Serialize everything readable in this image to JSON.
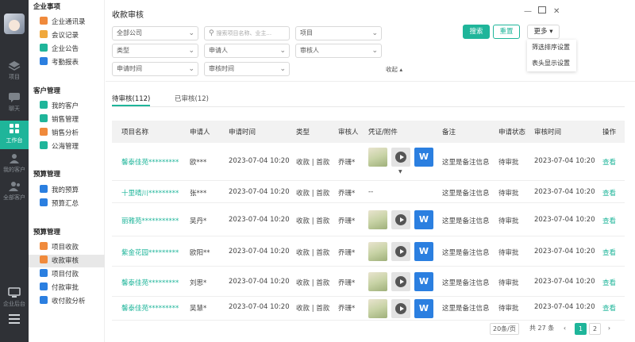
{
  "rail": {
    "items": [
      {
        "label": "项目",
        "icon": "layers-icon"
      },
      {
        "label": "聊天",
        "icon": "chat-icon"
      },
      {
        "label": "工作台",
        "icon": "grid-icon"
      },
      {
        "label": "我的客户",
        "icon": "users-icon"
      },
      {
        "label": "全部客户",
        "icon": "user-icon"
      },
      {
        "label": "企业后台",
        "icon": "monitor-icon"
      }
    ],
    "accent": "#1fb59a"
  },
  "submenu": {
    "sections": [
      {
        "title": "企业事项",
        "items": [
          "企业通讯录",
          "会议记录",
          "企业公告",
          "考勤报表"
        ]
      },
      {
        "title": "客户管理",
        "items": [
          "我的客户",
          "销售管理",
          "销售分析",
          "公海管理"
        ]
      },
      {
        "title": "预算管理",
        "items": [
          "我的预算",
          "预算汇总"
        ]
      },
      {
        "title": "预算管理",
        "items": [
          "项目收款",
          "收款审核",
          "项目付款",
          "付款审批",
          "收付款分析"
        ]
      }
    ],
    "active": "收款审核"
  },
  "page": {
    "title": "收款审核"
  },
  "filters": {
    "company": "全部公司",
    "search_placeholder": "搜索项目名称、业主...",
    "project": "项目",
    "type": "类型",
    "applicant": "申请人",
    "auditor": "审核人",
    "apply_time": "申请时间",
    "audit_time": "审核时间",
    "collapse": "收起"
  },
  "actions": {
    "search": "搜索",
    "reset": "重置",
    "more": "更多"
  },
  "more_menu": [
    "筛选排序设置",
    "表头显示设置"
  ],
  "tabs": [
    {
      "label": "待审核(112)",
      "active": true
    },
    {
      "label": "已审核(12)",
      "active": false
    }
  ],
  "table": {
    "columns": [
      "项目名称",
      "申请人",
      "申请时间",
      "类型",
      "审核人",
      "凭证/附件",
      "备注",
      "申请状态",
      "审核时间",
      "操作"
    ],
    "rows": [
      {
        "name": "馨泰佳苑*********",
        "applicant": "欧***",
        "time": "2023-07-04 10:20",
        "type": "收款 | 首款",
        "auditor": "乔珊*",
        "attachments": true,
        "note": "这里是备注信息",
        "status": "待审批",
        "audit_time": "2023-07-04 10:20",
        "op": "查看"
      },
      {
        "name": "十里晴川*********",
        "applicant": "张***",
        "time": "2023-07-04 10:20",
        "type": "收款 | 首款",
        "auditor": "乔珊*",
        "attachments": false,
        "att_text": "--",
        "note": "这里是备注信息",
        "status": "待审批",
        "audit_time": "2023-07-04 10:20",
        "op": "查看"
      },
      {
        "name": "丽雅苑***********",
        "applicant": "吴丹*",
        "time": "2023-07-04 10:20",
        "type": "收款 | 首款",
        "auditor": "乔珊*",
        "attachments": true,
        "note": "这里是备注信息",
        "status": "待审批",
        "audit_time": "2023-07-04 10:20",
        "op": "查看"
      },
      {
        "name": "紫金花园*********",
        "applicant": "欧阳**",
        "time": "2023-07-04 10:20",
        "type": "收款 | 首款",
        "auditor": "乔珊*",
        "attachments": true,
        "note": "这里是备注信息",
        "status": "待审批",
        "audit_time": "2023-07-04 10:20",
        "op": "查看"
      },
      {
        "name": "馨泰佳苑*********",
        "applicant": "刘思*",
        "time": "2023-07-04 10:20",
        "type": "收款 | 首款",
        "auditor": "乔珊*",
        "attachments": true,
        "note": "这里是备注信息",
        "status": "待审批",
        "audit_time": "2023-07-04 10:20",
        "op": "查看"
      },
      {
        "name": "馨泰佳苑*********",
        "applicant": "吴慧*",
        "time": "2023-07-04 10:20",
        "type": "收款 | 首款",
        "auditor": "乔珊*",
        "attachments": true,
        "note": "这里是备注信息",
        "status": "待审批",
        "audit_time": "2023-07-04 10:20",
        "op": "查看"
      }
    ]
  },
  "pagination": {
    "page_size": "20条/页",
    "total": "共 27 条",
    "pages": [
      "1",
      "2"
    ],
    "current": "1"
  }
}
